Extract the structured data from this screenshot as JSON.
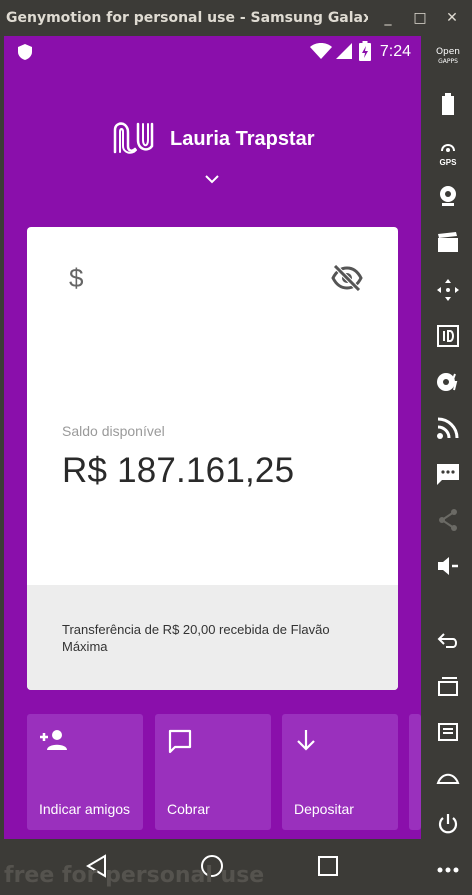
{
  "window": {
    "title": "Genymotion for personal use - Samsung Galaxy S...",
    "minimize_glyph": "_",
    "maximize_glyph": "□",
    "close_glyph": "✕"
  },
  "status_bar": {
    "time": "7:24",
    "icons": [
      "shield-icon",
      "wifi-icon",
      "signal-icon",
      "battery-charging-icon"
    ]
  },
  "header": {
    "user_name": "Lauria Trapstar"
  },
  "balance_card": {
    "currency_symbol": "$",
    "label": "Saldo disponível",
    "value": "R$ 187.161,25",
    "notification": "Transferência de R$ 20,00 recebida de Flavão Máxima"
  },
  "shortcuts": [
    {
      "label": "Indicar amigos",
      "icon": "add-person-icon"
    },
    {
      "label": "Cobrar",
      "icon": "chat-bubble-icon"
    },
    {
      "label": "Depositar",
      "icon": "arrow-down-icon"
    }
  ],
  "side_toolbar": {
    "open_gapps_line1": "Open",
    "open_gapps_line2": "GAPPS",
    "gps_label": "GPS"
  },
  "watermark": "free for personal use",
  "colors": {
    "nubank_purple": "#8a0fab",
    "shortcut_purple": "#9a30bd",
    "card_footer": "#ededed",
    "chrome": "#3c3b37"
  }
}
